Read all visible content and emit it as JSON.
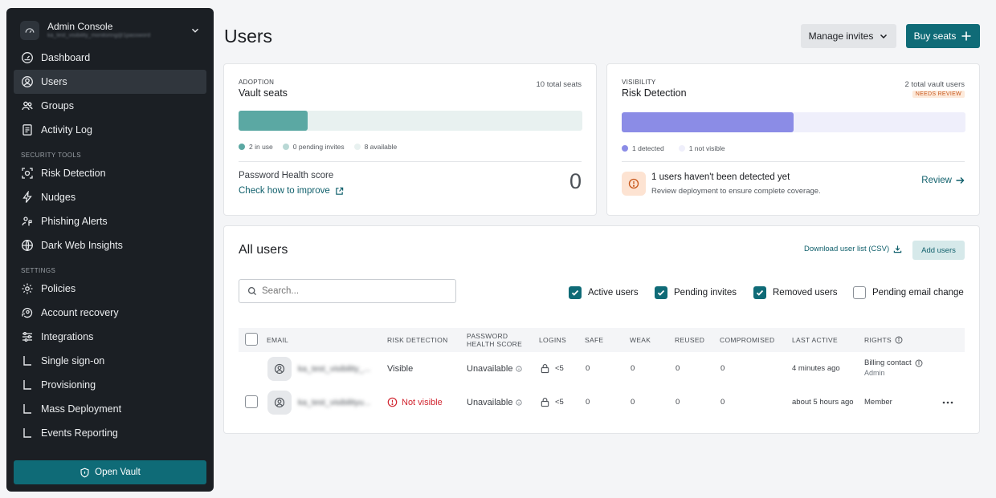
{
  "sidebar": {
    "account_title": "Admin Console",
    "account_subtitle": "ka_test_visibility_monitoring@1password",
    "nav_main": [
      {
        "label": "Dashboard",
        "icon": "gauge-icon"
      },
      {
        "label": "Users",
        "icon": "user-circle-icon",
        "active": true
      },
      {
        "label": "Groups",
        "icon": "group-icon"
      },
      {
        "label": "Activity Log",
        "icon": "document-icon"
      }
    ],
    "section_security": "SECURITY TOOLS",
    "nav_security": [
      {
        "label": "Risk Detection",
        "icon": "risk-icon"
      },
      {
        "label": "Nudges",
        "icon": "lightning-icon"
      },
      {
        "label": "Phishing Alerts",
        "icon": "fish-icon"
      },
      {
        "label": "Dark Web Insights",
        "icon": "globe-icon"
      }
    ],
    "section_settings": "SETTINGS",
    "nav_settings": [
      {
        "label": "Policies",
        "icon": "gear-icon"
      },
      {
        "label": "Account recovery",
        "icon": "recovery-icon"
      },
      {
        "label": "Integrations",
        "icon": "sliders-icon"
      },
      {
        "label": "Single sign-on",
        "icon": "sub-item-icon"
      },
      {
        "label": "Provisioning",
        "icon": "sub-item-icon"
      },
      {
        "label": "Mass Deployment",
        "icon": "sub-item-icon"
      },
      {
        "label": "Events Reporting",
        "icon": "sub-item-icon"
      }
    ],
    "open_vault": "Open Vault"
  },
  "header": {
    "title": "Users",
    "manage_invites": "Manage invites",
    "buy_seats": "Buy seats"
  },
  "adoption": {
    "eyebrow": "ADOPTION",
    "title": "Vault seats",
    "total": "10 total seats",
    "in_use": 2,
    "pending": 0,
    "total_seats": 10,
    "legend_in_use": "2 in use",
    "legend_pending": "0 pending invites",
    "legend_available": "8 available",
    "health_label": "Password Health score",
    "health_link": "Check how to improve",
    "health_score": "0"
  },
  "visibility": {
    "eyebrow": "VISIBILITY",
    "title": "Risk Detection",
    "total": "2 total vault users",
    "badge": "NEEDS REVIEW",
    "detected": 1,
    "total_users": 2,
    "legend_detected": "1 detected",
    "legend_not_visible": "1 not visible",
    "alert_title": "1 users haven't been detected yet",
    "alert_sub": "Review deployment to ensure complete coverage.",
    "review": "Review"
  },
  "users": {
    "title": "All users",
    "download": "Download user list (CSV)",
    "add_users": "Add users",
    "search_placeholder": "Search...",
    "filters": [
      {
        "label": "Active users",
        "checked": true
      },
      {
        "label": "Pending invites",
        "checked": true
      },
      {
        "label": "Removed users",
        "checked": true
      },
      {
        "label": "Pending email change",
        "checked": false
      }
    ],
    "columns": {
      "email": "EMAIL",
      "risk": "RISK DETECTION",
      "health_1": "PASSWORD",
      "health_2": "HEALTH SCORE",
      "logins": "LOGINS",
      "safe": "SAFE",
      "weak": "WEAK",
      "reused": "REUSED",
      "compromised": "COMPROMISED",
      "last_active": "LAST ACTIVE",
      "rights": "RIGHTS"
    },
    "rows": [
      {
        "email": "ka_test_visibility_...",
        "risk": "Visible",
        "health": "Unavailable",
        "logins": "<5",
        "safe": "0",
        "weak": "0",
        "reused": "0",
        "compromised": "0",
        "last_active": "4 minutes ago",
        "rights": "Billing contact",
        "rights_sub": "Admin"
      },
      {
        "email": "ka_test_visibilityu...",
        "risk": "Not visible",
        "health": "Unavailable",
        "logins": "<5",
        "safe": "0",
        "weak": "0",
        "reused": "0",
        "compromised": "0",
        "last_active": "about 5 hours ago",
        "rights": "Member",
        "rights_sub": ""
      }
    ]
  },
  "colors": {
    "accent": "#0f6b77",
    "adoption_fill": "#5ba8a3",
    "adoption_track": "#e8f1f0",
    "visibility_fill": "#8b8ce6",
    "visibility_track": "#efeffb",
    "danger": "#d1242f"
  }
}
